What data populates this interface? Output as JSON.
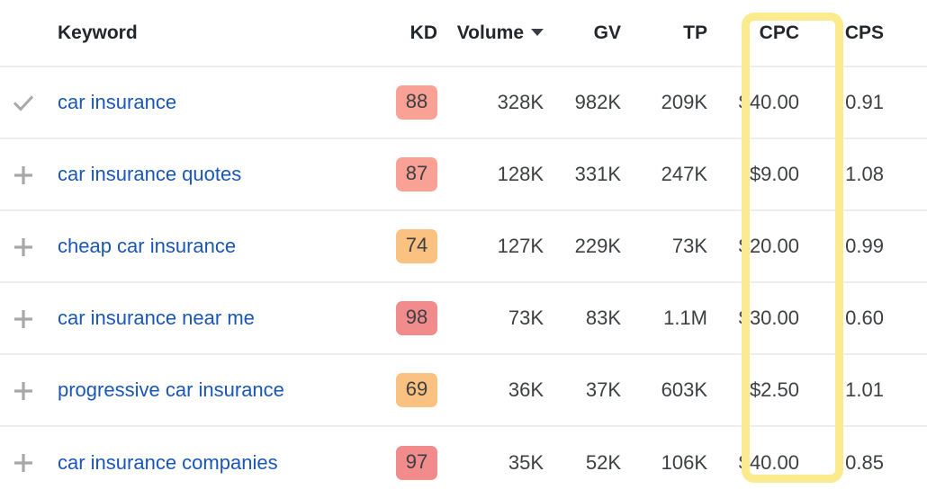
{
  "table": {
    "columns": [
      {
        "key": "check",
        "label": "",
        "align": "center"
      },
      {
        "key": "keyword",
        "label": "Keyword",
        "align": "left"
      },
      {
        "key": "kd",
        "label": "KD",
        "align": "right"
      },
      {
        "key": "volume",
        "label": "Volume",
        "align": "right",
        "sorted": true,
        "sort_dir": "desc",
        "sort_icon": "caret-down-icon"
      },
      {
        "key": "gv",
        "label": "GV",
        "align": "right"
      },
      {
        "key": "tp",
        "label": "TP",
        "align": "right"
      },
      {
        "key": "cpc",
        "label": "CPC",
        "align": "right",
        "highlighted": true
      },
      {
        "key": "cps",
        "label": "CPS",
        "align": "right"
      }
    ],
    "rows": [
      {
        "icon": "check-icon",
        "selected": true,
        "keyword": "car insurance",
        "kd": "88",
        "kd_color": "#faa195",
        "volume": "328K",
        "gv": "982K",
        "tp": "209K",
        "cpc": "$40.00",
        "cps": "0.91"
      },
      {
        "icon": "plus-icon",
        "selected": false,
        "keyword": "car insurance quotes",
        "kd": "87",
        "kd_color": "#faa195",
        "volume": "128K",
        "gv": "331K",
        "tp": "247K",
        "cpc": "$9.00",
        "cps": "1.08"
      },
      {
        "icon": "plus-icon",
        "selected": false,
        "keyword": "cheap car insurance",
        "kd": "74",
        "kd_color": "#fbc180",
        "volume": "127K",
        "gv": "229K",
        "tp": "73K",
        "cpc": "$20.00",
        "cps": "0.99"
      },
      {
        "icon": "plus-icon",
        "selected": false,
        "keyword": "car insurance near me",
        "kd": "98",
        "kd_color": "#f28b8b",
        "volume": "73K",
        "gv": "83K",
        "tp": "1.1M",
        "cpc": "$30.00",
        "cps": "0.60"
      },
      {
        "icon": "plus-icon",
        "selected": false,
        "keyword": "progressive car insurance",
        "kd": "69",
        "kd_color": "#fbc180",
        "volume": "36K",
        "gv": "37K",
        "tp": "603K",
        "cpc": "$2.50",
        "cps": "1.01"
      },
      {
        "icon": "plus-icon",
        "selected": false,
        "keyword": "car insurance companies",
        "kd": "97",
        "kd_color": "#f28b8b",
        "volume": "35K",
        "gv": "52K",
        "tp": "106K",
        "cpc": "$40.00",
        "cps": "0.85"
      }
    ]
  },
  "highlight": {
    "target_column": "CPC",
    "color": "#fbeb8e",
    "shape": "rounded-rectangle-outline"
  },
  "colors": {
    "link": "#1a56b8",
    "text": "#3c4043",
    "header_text": "#23272b",
    "row_border": "#eceef0",
    "icon_gray": "#a8a8a8",
    "highlight_yellow": "#fbeb8e"
  }
}
